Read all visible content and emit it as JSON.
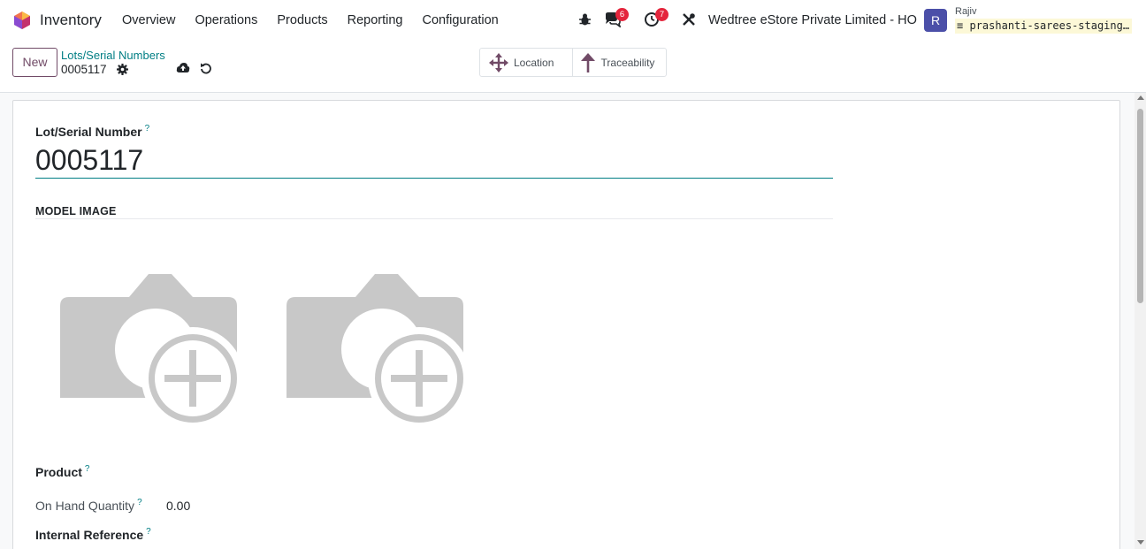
{
  "navbar": {
    "app_name": "Inventory",
    "menu": [
      "Overview",
      "Operations",
      "Products",
      "Reporting",
      "Configuration"
    ],
    "messages_count": "6",
    "activities_count": "7",
    "company": "Wedtree eStore Private Limited - HO",
    "user_initial": "R",
    "user_name": "Rajiv",
    "database": "prashanti-sarees-staging…",
    "icons": [
      "bug-icon",
      "chat-icon",
      "clock-icon",
      "tools-icon"
    ]
  },
  "control_panel": {
    "new_label": "New",
    "breadcrumb_parent": "Lots/Serial Numbers",
    "breadcrumb_current": "0005117",
    "smart_buttons": {
      "location_label": "Location",
      "traceability_label": "Traceability"
    }
  },
  "form": {
    "lot_label": "Lot/Serial Number",
    "lot_value": "0005117",
    "help_marker": "?",
    "model_image_title": "MODEL IMAGE",
    "product_label": "Product",
    "on_hand_label": "On Hand Quantity",
    "on_hand_value": "0.00",
    "internal_ref_label": "Internal Reference"
  },
  "colors": {
    "brand": "#714b67",
    "link": "#017e84",
    "badge": "#e4253c",
    "avatar": "#4b4fa8"
  }
}
